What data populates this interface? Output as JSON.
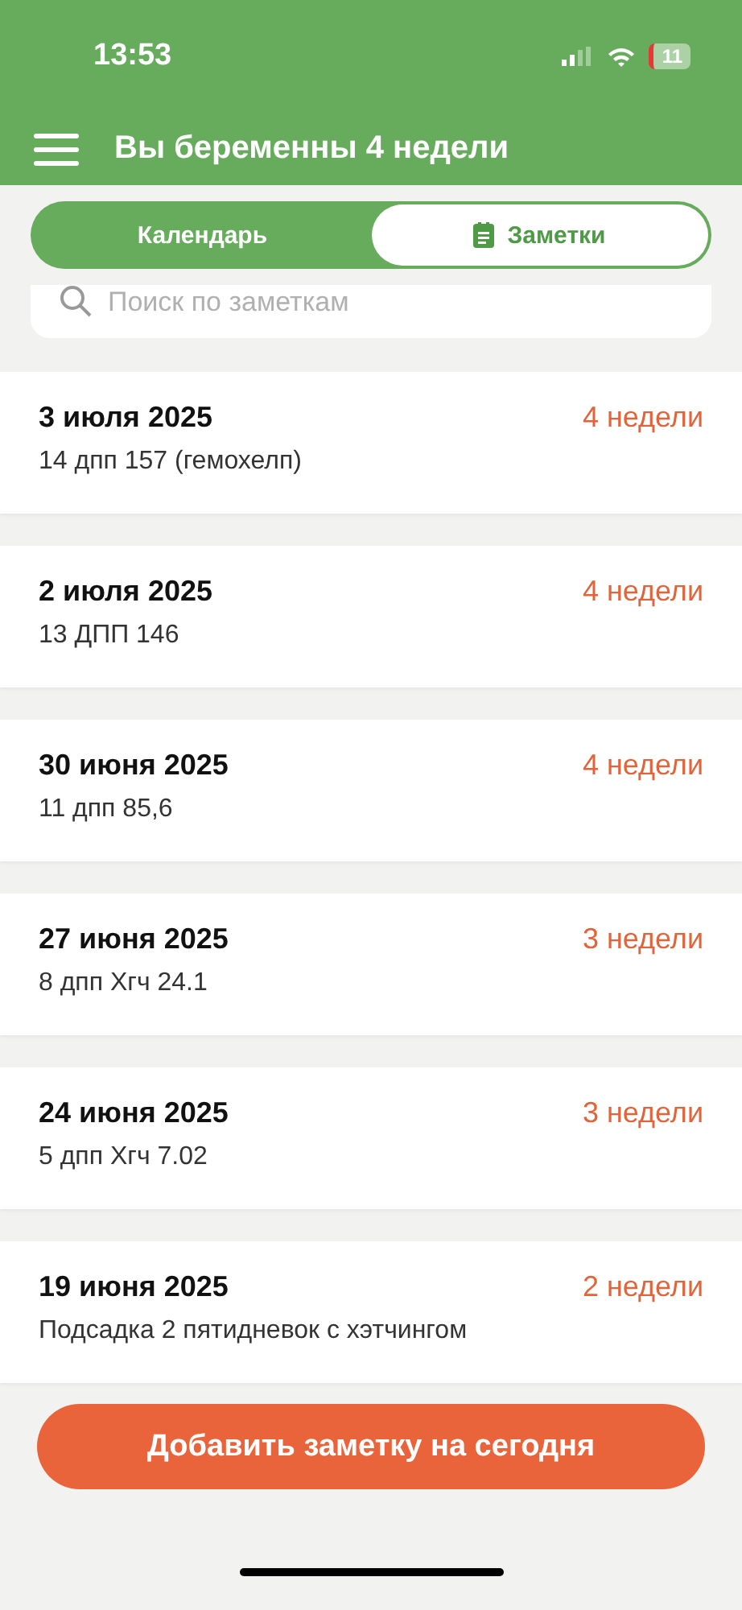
{
  "status_bar": {
    "time": "13:53",
    "battery": "11"
  },
  "header": {
    "title": "Вы беременны 4 недели"
  },
  "tabs": [
    {
      "label": "Календарь",
      "selected": false
    },
    {
      "label": "Заметки",
      "selected": true
    }
  ],
  "search": {
    "placeholder": "Поиск по заметкам"
  },
  "notes": [
    {
      "date": "3 июля 2025",
      "weeks": "4 недели",
      "text": "14 дпп 157 (гемохелп)"
    },
    {
      "date": "2 июля 2025",
      "weeks": "4 недели",
      "text": "13 ДПП 146"
    },
    {
      "date": "30 июня 2025",
      "weeks": "4 недели",
      "text": "11 дпп 85,6"
    },
    {
      "date": "27 июня 2025",
      "weeks": "3 недели",
      "text": "8 дпп Хгч 24.1"
    },
    {
      "date": "24 июня 2025",
      "weeks": "3 недели",
      "text": "5 дпп Хгч 7.02"
    },
    {
      "date": "19 июня 2025",
      "weeks": "2 недели",
      "text": "Подсадка 2 пятидневок с хэтчингом"
    }
  ],
  "add_button": "Добавить заметку на сегодня"
}
